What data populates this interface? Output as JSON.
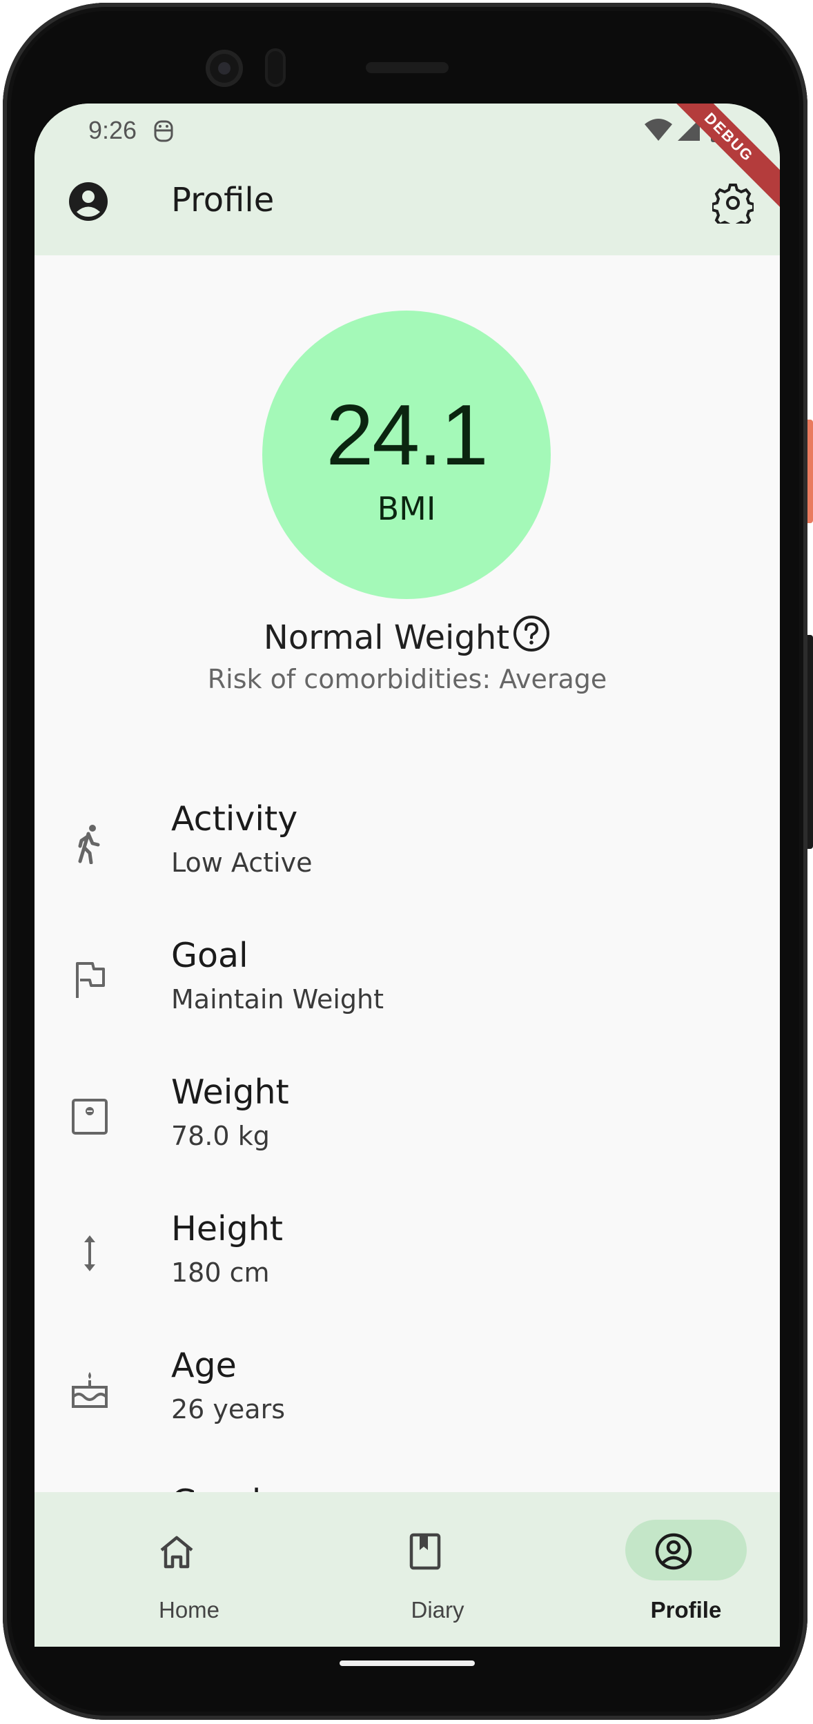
{
  "status_bar": {
    "time": "9:26"
  },
  "debug_banner": "DEBUG",
  "app_bar": {
    "title": "Profile",
    "leading_icon": "account-circle-icon",
    "action_icon": "settings-gear-icon"
  },
  "bmi": {
    "value": "24.1",
    "label": "BMI",
    "classification": "Normal Weight",
    "risk": "Risk of comorbidities: Average",
    "circle_color": "#a4f9b8"
  },
  "profile_items": [
    {
      "title": "Activity",
      "value": "Low Active",
      "icon": "walking-person-icon"
    },
    {
      "title": "Goal",
      "value": "Maintain Weight",
      "icon": "flag-icon"
    },
    {
      "title": "Weight",
      "value": "78.0 kg",
      "icon": "scale-icon"
    },
    {
      "title": "Height",
      "value": "180 cm",
      "icon": "vertical-arrows-icon"
    },
    {
      "title": "Age",
      "value": "26 years",
      "icon": "cake-icon"
    },
    {
      "title": "Gender",
      "value": "",
      "icon": ""
    }
  ],
  "bottom_nav": {
    "items": [
      {
        "label": "Home",
        "icon": "home-icon",
        "active": false
      },
      {
        "label": "Diary",
        "icon": "book-icon",
        "active": false
      },
      {
        "label": "Profile",
        "icon": "account-circle-icon",
        "active": true
      }
    ]
  },
  "colors": {
    "accent_bar": "#e4f0e4",
    "active_pill": "#c4e6c8",
    "bmi_circle": "#a4f9b8"
  }
}
